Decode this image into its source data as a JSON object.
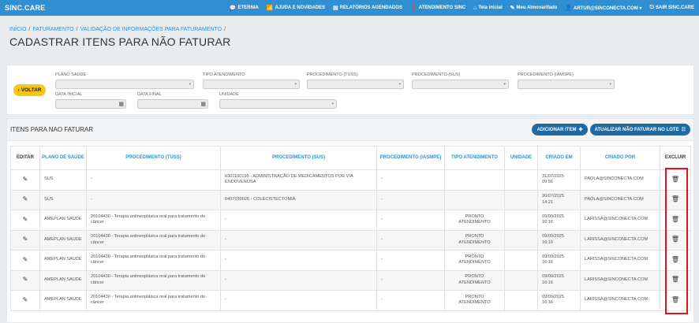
{
  "app": {
    "brand": "SINC.CARE"
  },
  "topnav": [
    {
      "icon": "chat-icon",
      "glyph": "💬",
      "label": "ETERNIA"
    },
    {
      "icon": "rss-icon",
      "glyph": "📶",
      "label": "AJUDA E NOVIDADES"
    },
    {
      "icon": "report-icon",
      "glyph": "▤",
      "label": "RELATÓRIOS AGENDADOS"
    },
    {
      "icon": "help-icon",
      "glyph": "❓",
      "label": "ATENDIMENTO SINC"
    },
    {
      "icon": "home-icon",
      "glyph": "⌂",
      "label": "Tela inicial"
    },
    {
      "icon": "edit-icon",
      "glyph": "✎",
      "label": "Meu Almoxarifado"
    },
    {
      "icon": "user-icon",
      "glyph": "👤",
      "label": "ARTUR@SINCONECTA.COM ▾"
    },
    {
      "icon": "logout-icon",
      "glyph": "⎋",
      "label": "SAIR SINC.CARE"
    }
  ],
  "breadcrumb": [
    "INÍCIO",
    "FATURAMENTO",
    "VALIDAÇÃO DE INFORMAÇÕES PARA FATURAMENTO"
  ],
  "page_title": "CADASTRAR ITENS PARA NÃO FATURAR",
  "filters": {
    "voltar_label": "VOLTAR",
    "plano_saude": "PLANO SAÚDE",
    "tipo_atendimento": "TIPO ATENDIMENTO",
    "proc_tuss": "PROCEDIMENTO (TUSS)",
    "proc_sus": "PROCEDIMENTO (SUS)",
    "proc_iamspe": "PROCEDIMENTO (IAMSPE)",
    "data_inicial": "DATA INICIAL",
    "data_final": "DATA FINAL",
    "unidade": "UNIDADE"
  },
  "panel": {
    "title": "ITENS PARA NAO FATURAR",
    "add_label": "ADICIONAR ITEM",
    "update_label": "ATUALIZAR NÃO FATURAR NO LOTE"
  },
  "table": {
    "headers": [
      "EDITAR",
      "PLANO DE SAÚDE",
      "PROCEDIMENTO (TUSS)",
      "PROCEDIMENTO (SUS)",
      "PROCEDIMENTO (IASMPE)",
      "TIPO ATENDIMENTO",
      "UNIDADE",
      "CRIADO EM",
      "CRIADO POR",
      "EXCLUIR"
    ],
    "rows": [
      {
        "plano": "SUS",
        "tuss": "-",
        "sus": "0301100195 - ADMINISTRAÇÃO DE MEDICAMENTOS POR VIA ENDOVENOSA",
        "iamspe": "-",
        "tipo": "",
        "unidade": "",
        "criado_em": "31/07/2025 09:56",
        "criado_por": "PAOLA@SINCONECTA.COM"
      },
      {
        "plano": "SUS",
        "tuss": "-",
        "sus": "0407030026 - COLECISTECTOMIA",
        "iamspe": "-",
        "tipo": "",
        "unidade": "",
        "criado_em": "30/07/2025 14:21",
        "criado_por": "PAOLA@SINCONECTA.COM"
      },
      {
        "plano": "AMEPLAN SAUDE",
        "tuss": "20104430 - Terapia antineoplásica oral para tratamento do câncer",
        "sus": "-",
        "iamspe": "-",
        "tipo": "PRONTO ATENDIMENTO",
        "unidade": "",
        "criado_em": "09/09/2025 16:16",
        "criado_por": "LARISSA@SINCONECTA.COM"
      },
      {
        "plano": "AMEPLAN SAUDE",
        "tuss": "20104430 - Terapia antineoplásica oral para tratamento do câncer",
        "sus": "-",
        "iamspe": "-",
        "tipo": "PRONTO ATENDIMENTO",
        "unidade": "",
        "criado_em": "09/09/2025 16:16",
        "criado_por": "LARISSA@SINCONECTA.COM"
      },
      {
        "plano": "AMEPLAN SAUDE",
        "tuss": "20104430 - Terapia antineoplásica oral para tratamento do câncer",
        "sus": "-",
        "iamspe": "-",
        "tipo": "PRONTO ATENDIMENTO",
        "unidade": "",
        "criado_em": "09/09/2025 16:16",
        "criado_por": "LARISSA@SINCONECTA.COM"
      },
      {
        "plano": "AMEPLAN SAUDE",
        "tuss": "20104430 - Terapia antineoplásica oral para tratamento do câncer",
        "sus": "-",
        "iamspe": "-",
        "tipo": "PRONTO ATENDIMENTO",
        "unidade": "",
        "criado_em": "09/09/2025 16:16",
        "criado_por": "LARISSA@SINCONECTA.COM"
      },
      {
        "plano": "AMEPLAN SAUDE",
        "tuss": "20104430 - Terapia antineoplásica oral para tratamento do câncer",
        "sus": "-",
        "iamspe": "-",
        "tipo": "PRONTO ATENDIMENTO",
        "unidade": "",
        "criado_em": "09/09/2025 16:16",
        "criado_por": "LARISSA@SINCONECTA.COM"
      }
    ]
  },
  "colors": {
    "topbar": "#2f8fd0",
    "accent_button": "#1f6aa5",
    "voltar": "#f6c515",
    "highlight": "#e0121d"
  }
}
